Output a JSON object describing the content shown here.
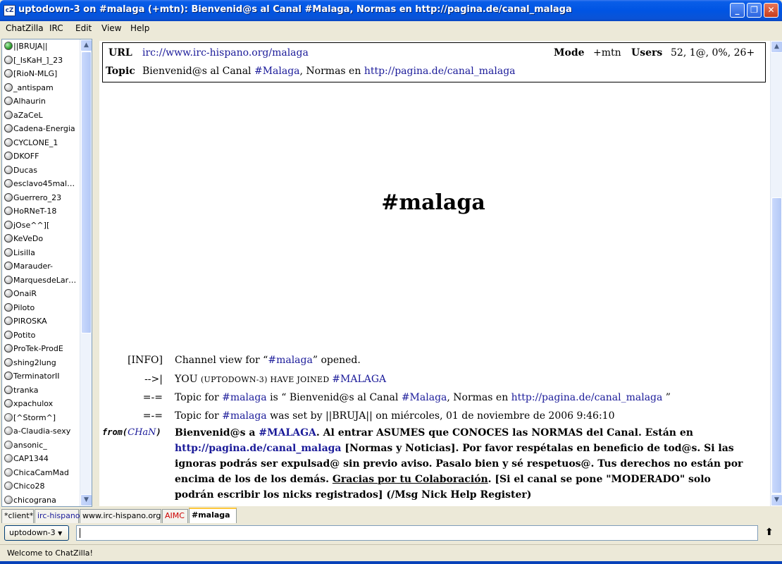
{
  "window": {
    "title": "uptodown-3 on #malaga (+mtn):  Bienvenid@s al Canal #Malaga, Normas en http://pagina.de/canal_malaga",
    "app_icon_text": "cZ"
  },
  "menu": [
    "ChatZilla",
    "IRC",
    "Edit",
    "View",
    "Help"
  ],
  "userlist": [
    {
      "nick": "||BRUJA||",
      "status": "op"
    },
    {
      "nick": "[_IsKaH_]_23",
      "status": "voice"
    },
    {
      "nick": "[RioN-MLG]",
      "status": "voice"
    },
    {
      "nick": "_antispam",
      "status": "voice"
    },
    {
      "nick": "Alhaurin",
      "status": "voice"
    },
    {
      "nick": "aZaCeL",
      "status": "voice"
    },
    {
      "nick": "Cadena-Energia",
      "status": "voice"
    },
    {
      "nick": "CYCLONE_1",
      "status": "voice"
    },
    {
      "nick": "DKOFF",
      "status": "voice"
    },
    {
      "nick": "Ducas",
      "status": "voice"
    },
    {
      "nick": "esclavo45mal…",
      "status": "voice"
    },
    {
      "nick": "Guerrero_23",
      "status": "voice"
    },
    {
      "nick": "HoRNeT-18",
      "status": "voice"
    },
    {
      "nick": "jOse^^][",
      "status": "voice"
    },
    {
      "nick": "KeVeDo",
      "status": "voice"
    },
    {
      "nick": "Lisilla",
      "status": "voice"
    },
    {
      "nick": "Marauder-",
      "status": "voice"
    },
    {
      "nick": "MarquesdeLar…",
      "status": "voice"
    },
    {
      "nick": "OnaiR",
      "status": "voice"
    },
    {
      "nick": "Piloto",
      "status": "voice"
    },
    {
      "nick": "PIROSKA",
      "status": "voice"
    },
    {
      "nick": "Potito",
      "status": "voice"
    },
    {
      "nick": "ProTek-ProdE",
      "status": "voice"
    },
    {
      "nick": "shing2lung",
      "status": "voice"
    },
    {
      "nick": "TerminatorII",
      "status": "voice"
    },
    {
      "nick": "tranka",
      "status": "voice"
    },
    {
      "nick": "xpachulox",
      "status": "voice"
    },
    {
      "nick": "[^Storm^]",
      "status": "normal"
    },
    {
      "nick": "a-Claudia-sexy",
      "status": "normal"
    },
    {
      "nick": "ansonic_",
      "status": "normal"
    },
    {
      "nick": "CAP1344",
      "status": "normal"
    },
    {
      "nick": "ChicaCamMad",
      "status": "normal"
    },
    {
      "nick": "Chico28",
      "status": "normal"
    },
    {
      "nick": "chicograna",
      "status": "normal"
    }
  ],
  "header": {
    "url_label": "URL",
    "url_value": "irc://www.irc-hispano.org/malaga",
    "mode_label": "Mode",
    "mode_value": "+mtn",
    "users_label": "Users",
    "users_value": "52, 1@, 0%, 26+",
    "topic_label": "Topic",
    "topic_pre": "Bienvenid@s al Canal ",
    "topic_channel": "#Malaga",
    "topic_mid": ", Normas en ",
    "topic_link": "http://pagina.de/canal_malaga"
  },
  "channel_title": "#malaga",
  "messages": {
    "m1_code": "[INFO]",
    "m1_pre": "Channel view for “",
    "m1_chan": "#malaga",
    "m1_post": "” opened.",
    "m2_code": "-->|",
    "m2_pre": "YOU ",
    "m2_small": "(UPTODOWN-3) HAVE JOINED ",
    "m2_chan": "#MALAGA",
    "m3_code": "=-=",
    "m3_pre": "Topic for ",
    "m3_chan": "#malaga",
    "m3_mid": " is “ Bienvenid@s al Canal ",
    "m3_chan2": "#Malaga",
    "m3_mid2": ", Normas en ",
    "m3_link": "http://pagina.de/canal_malaga",
    "m3_post": " ”",
    "m4_code": "=-=",
    "m4_pre": "Topic for ",
    "m4_chan": "#malaga",
    "m4_post": " was set by ||BRUJA|| on miércoles, 01 de noviembre de 2006 9:46:10",
    "from_prefix": "from(",
    "from_nick": "CHaN",
    "from_suffix": ")",
    "notice_a": "Bienvenid@s a ",
    "notice_chan": "#MALAGA",
    "notice_b": ". Al entrar ASUMES que CONOCES las NORMAS del Canal. Están en ",
    "notice_link": "http://pagina.de/canal_malaga",
    "notice_c": " [Normas y Noticias]. Por favor respétalas en beneficio de tod@s. Si las ignoras podrás ser expulsad@ sin previo aviso. Pasalo bien y sé respetuos@. Tus derechos no están por encima de los de los demás. ",
    "notice_underline": "Gracias por tu Colaboración",
    "notice_d": ". [Si el canal se pone \"MODERADO\" solo podrán escribir los nicks registrados] (/Msg Nick Help Register)"
  },
  "tabs": [
    {
      "label": "*client*",
      "color": "#000000"
    },
    {
      "label": "irc-hispano",
      "color": "#1a1a99"
    },
    {
      "label": "www.irc-hispano.org",
      "color": "#000000"
    },
    {
      "label": "AIMC",
      "color": "#cc0000"
    },
    {
      "label": "#malaga",
      "color": "#000000"
    }
  ],
  "input": {
    "nick_button": "uptodown-3",
    "value": ""
  },
  "status": "Welcome to ChatZilla!"
}
